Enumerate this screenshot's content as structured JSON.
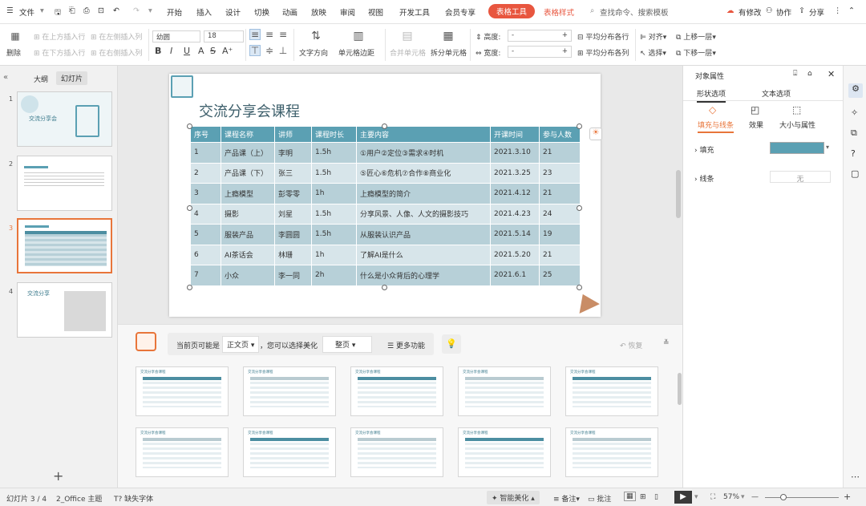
{
  "menu": {
    "file": "文件",
    "items": [
      "开始",
      "插入",
      "设计",
      "切换",
      "动画",
      "放映",
      "审阅",
      "视图",
      "开发工具",
      "会员专享"
    ],
    "ctx_table_tool": "表格工具",
    "ctx_table_style": "表格样式",
    "search": "查找命令、搜索模板",
    "has_changes": "有修改",
    "collab": "协作",
    "share": "分享"
  },
  "ribbon": {
    "delete": "删除",
    "insert_above": "在上方插入行",
    "insert_below": "在下方插入行",
    "insert_left": "在左侧插入列",
    "insert_right": "在右侧插入列",
    "font": "幼圆",
    "font_size": "18",
    "text_direction": "文字方向",
    "cell_margin": "单元格边距",
    "merge": "合并单元格",
    "split": "拆分单元格",
    "height_label": "高度:",
    "width_label": "宽度:",
    "dist_rows": "平均分布各行",
    "dist_cols": "平均分布各列",
    "align": "对齐",
    "select": "选择",
    "bring_forward": "上移一层",
    "send_backward": "下移一层",
    "bold": "B",
    "italic": "I",
    "underline": "U",
    "strike": "S"
  },
  "left": {
    "tab_outline": "大纲",
    "tab_slides": "幻灯片",
    "nums": [
      "1",
      "2",
      "3",
      "4"
    ],
    "t1_title": "交流分享会",
    "t4_title": "交流分享"
  },
  "slide": {
    "title": "交流分享会课程",
    "headers": [
      "序号",
      "课程名称",
      "讲师",
      "课程时长",
      "主要内容",
      "开课时间",
      "参与人数"
    ],
    "rows": [
      [
        "1",
        "产品课（上）",
        "李明",
        "1.5h",
        "①用户②定位③需求④时机",
        "2021.3.10",
        "21"
      ],
      [
        "2",
        "产品课（下）",
        "张三",
        "1.5h",
        "⑤匠心⑥危机⑦合作⑧商业化",
        "2021.3.25",
        "23"
      ],
      [
        "3",
        "上瘾模型",
        "彭零零",
        "1h",
        "上瘾模型的简介",
        "2021.4.12",
        "21"
      ],
      [
        "4",
        "摄影",
        "刘星",
        "1.5h",
        "分享风景、人像、人文的摄影技巧",
        "2021.4.23",
        "24"
      ],
      [
        "5",
        "服装产品",
        "李圆圆",
        "1.5h",
        "从服装认识产品",
        "2021.5.14",
        "19"
      ],
      [
        "6",
        "AI茶话会",
        "林珊",
        "1h",
        "了解AI是什么",
        "2021.5.20",
        "21"
      ],
      [
        "7",
        "小众",
        "李一同",
        "2h",
        "什么是小众背后的心理学",
        "2021.6.1",
        "25"
      ]
    ]
  },
  "beautify": {
    "label1": "当前页可能是",
    "page_type": "正文页",
    "label2": "，您可以选择美化",
    "scope": "整页",
    "more": "更多功能",
    "restore": "恢复",
    "tpl_title": "交流分享会课程"
  },
  "panel": {
    "title": "对象属性",
    "tab_shape": "形状选项",
    "tab_text": "文本选项",
    "sub_fill": "填充与线条",
    "sub_effect": "效果",
    "sub_size": "大小与属性",
    "fill": "填充",
    "line": "线条",
    "line_value": "无",
    "fill_color": "#5ba0b3"
  },
  "status": {
    "slide": "幻灯片 3 / 4",
    "theme": "2_Office 主题",
    "missing_font": "缺失字体",
    "smart": "智能美化",
    "notes": "备注",
    "comment": "批注",
    "zoom": "57%"
  },
  "colors": {
    "accent": "#e8563f",
    "teal": "#5ba0b3"
  }
}
